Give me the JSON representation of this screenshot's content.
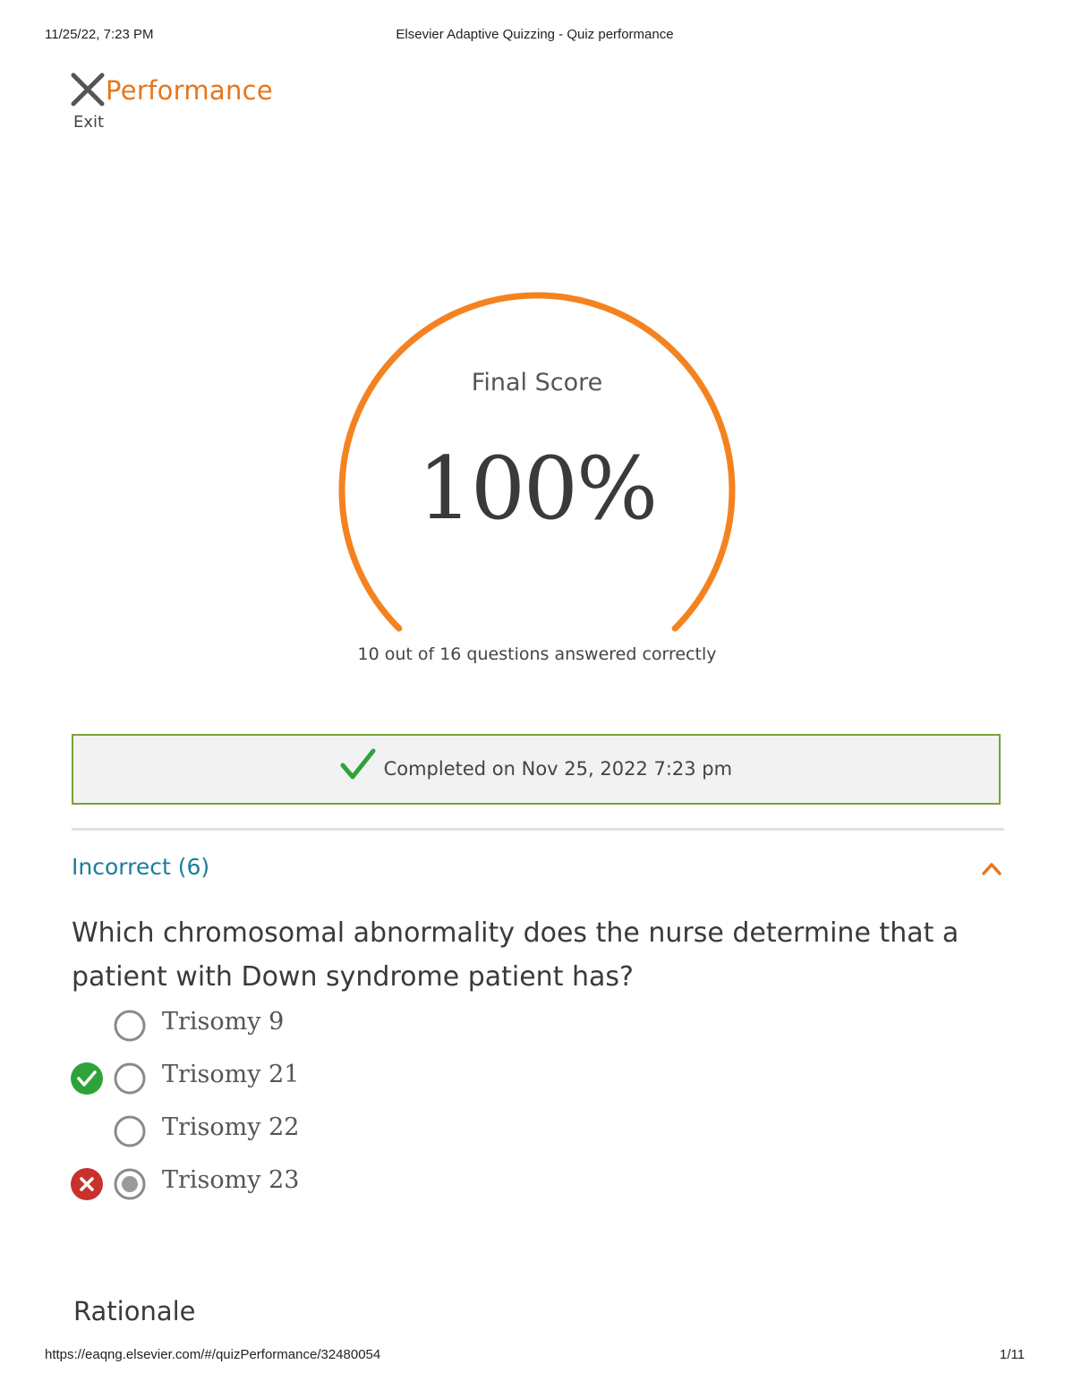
{
  "print_header": {
    "datetime": "11/25/22, 7:23 PM",
    "page_title": "Elsevier Adaptive Quizzing - Quiz performance"
  },
  "print_footer": {
    "url": "https://eaqng.elsevier.com/#/quizPerformance/32480054",
    "page_number": "1/11"
  },
  "header": {
    "title": "Performance",
    "exit_label": "Exit"
  },
  "score": {
    "label": "Final Score",
    "value": "100%",
    "fraction": 1.0,
    "caption": "10 out of 16 questions answered correctly"
  },
  "completed": {
    "text": "Completed on Nov 25, 2022 7:23 pm"
  },
  "section": {
    "title": "Incorrect (6)",
    "expanded": true
  },
  "question": {
    "text": "Which chromosomal abnormality does the nurse determine that a patient with Down syndrome patient has?",
    "options": [
      {
        "label": "Trisomy 9",
        "mark": "none",
        "selected": false
      },
      {
        "label": "Trisomy 21",
        "mark": "correct",
        "selected": false
      },
      {
        "label": "Trisomy 22",
        "mark": "none",
        "selected": false
      },
      {
        "label": "Trisomy 23",
        "mark": "incorrect",
        "selected": true
      }
    ]
  },
  "rationale": {
    "heading": "Rationale"
  },
  "colors": {
    "accent_orange": "#e8761a",
    "gauge_orange": "#f58220",
    "teal_link": "#1a7d9c",
    "success_green": "#2ea33a",
    "error_red": "#c8312c",
    "border_green": "#7aa23a"
  }
}
